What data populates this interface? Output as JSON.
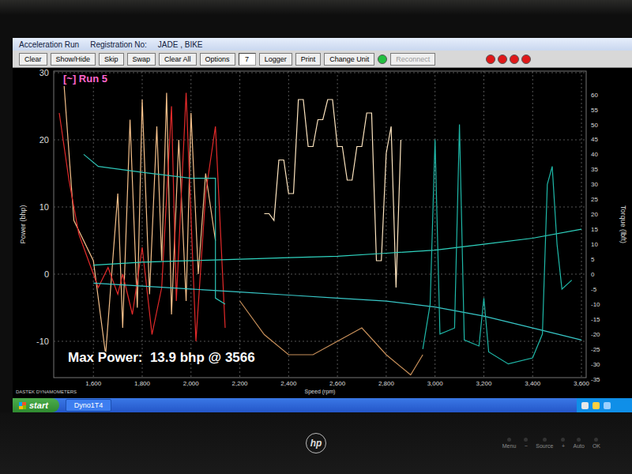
{
  "window": {
    "title": "Acceleration Run",
    "registration_label": "Registration No:",
    "registration": "JADE , BIKE"
  },
  "toolbar": [
    {
      "kind": "button",
      "label": "Clear",
      "disabled": false
    },
    {
      "kind": "button",
      "label": "Show/Hide",
      "disabled": false
    },
    {
      "kind": "button",
      "label": "Skip",
      "disabled": false
    },
    {
      "kind": "button",
      "label": "Swap",
      "disabled": false
    },
    {
      "kind": "button",
      "label": "Clear All",
      "disabled": false
    },
    {
      "kind": "button",
      "label": "Options",
      "disabled": false
    },
    {
      "kind": "field",
      "value": "7"
    },
    {
      "kind": "button",
      "label": "Logger",
      "disabled": false
    },
    {
      "kind": "button",
      "label": "Print",
      "disabled": false
    },
    {
      "kind": "button",
      "label": "Change Unit",
      "disabled": false
    },
    {
      "kind": "led",
      "color": "#22c040"
    },
    {
      "kind": "button",
      "label": "Reconnect",
      "disabled": true
    }
  ],
  "alarm_lights": [
    {
      "color": "#e01818"
    },
    {
      "color": "#e01818"
    },
    {
      "color": "#e01818"
    },
    {
      "color": "#e01818"
    }
  ],
  "chart": {
    "run_label": "[~] Run 5",
    "y_left": {
      "title": "Power (bhp)",
      "ticks": [
        "30",
        "20",
        "10",
        "0",
        "-10"
      ]
    },
    "y_right": {
      "title": "Torque (lbft)",
      "ticks": [
        "60",
        "55",
        "50",
        "45",
        "40",
        "35",
        "30",
        "25",
        "20",
        "15",
        "10",
        "5",
        "0",
        "-5",
        "-10",
        "-15",
        "-20",
        "-25",
        "-30",
        "-35"
      ]
    },
    "x": {
      "title": "Speed (rpm)",
      "ticks": [
        "1,600",
        "1,800",
        "2,000",
        "2,200",
        "2,400",
        "2,600",
        "2,800",
        "3,000",
        "3,200",
        "3,400",
        "3,600"
      ]
    },
    "series": [
      {
        "axis": "left",
        "color": "#f5c08a",
        "rpm": [
          1480,
          1520,
          1600,
          1650,
          1700,
          1720,
          1750,
          1780,
          1800,
          1830,
          1860,
          1880,
          1900,
          1920,
          1950,
          1980,
          2000,
          2030,
          2060,
          2100
        ],
        "values": [
          28,
          8,
          2,
          -12,
          12,
          -8,
          23,
          -5,
          26,
          -3,
          22,
          2,
          27,
          -6,
          20,
          -4,
          24,
          0,
          15,
          5
        ]
      },
      {
        "axis": "left",
        "color": "#ffe6c0",
        "rpm": [
          2300,
          2320,
          2340,
          2360,
          2380,
          2400,
          2420,
          2440,
          2460,
          2480,
          2500,
          2520,
          2540,
          2560,
          2580,
          2600,
          2620,
          2640,
          2660,
          2680,
          2700,
          2720,
          2740,
          2760,
          2780,
          2800,
          2820,
          2840,
          2860
        ],
        "values": [
          9,
          9,
          8,
          17,
          17,
          12,
          12,
          26,
          26,
          19,
          19,
          23,
          23,
          26,
          26,
          19,
          19,
          14,
          14,
          19,
          19,
          24,
          24,
          2,
          2,
          18,
          22,
          -2,
          20
        ]
      },
      {
        "axis": "left",
        "color": "#e52a2a",
        "rpm": [
          1460,
          1500,
          1540,
          1580,
          1620,
          1660,
          1700,
          1720,
          1760,
          1800,
          1840,
          1880,
          1920,
          1940,
          1980,
          2020,
          2060,
          2100,
          2140
        ],
        "values": [
          24,
          14,
          6,
          2,
          -2,
          1,
          -3,
          0,
          -6,
          4,
          -9,
          -2,
          25,
          -4,
          27,
          -10,
          12,
          22,
          -8
        ]
      },
      {
        "axis": "left",
        "color": "#c8905a",
        "rpm": [
          2200,
          2300,
          2400,
          2500,
          2600,
          2700,
          2800,
          2900,
          2950
        ],
        "values": [
          -4,
          -9,
          -12,
          -12,
          -10,
          -8,
          -12,
          -15,
          -12
        ]
      },
      {
        "axis": "right",
        "color": "#2fd4c0",
        "rpm": [
          1600,
          1800,
          2000,
          2200,
          2400,
          2600,
          2800,
          3000,
          3200,
          3400,
          3600
        ],
        "values": [
          3,
          4,
          4.5,
          5,
          5.5,
          6,
          7,
          8,
          10,
          12,
          15
        ]
      },
      {
        "axis": "right",
        "color": "#38c8c8",
        "rpm": [
          1600,
          1800,
          2000,
          2200,
          2400,
          2600,
          2800,
          3000,
          3200,
          3400,
          3600
        ],
        "values": [
          -3,
          -4,
          -5,
          -6,
          -7,
          -8,
          -9,
          -11,
          -14,
          -18,
          -22
        ]
      },
      {
        "axis": "right",
        "color": "#2ec4b6",
        "rpm": [
          1560,
          1620,
          1800,
          2000,
          2100,
          2100,
          2140
        ],
        "values": [
          40,
          36,
          34,
          32,
          32,
          -8,
          -10
        ]
      },
      {
        "axis": "right",
        "color": "#1fb8a8",
        "rpm": [
          2950,
          2980,
          3000,
          3020,
          3080,
          3100,
          3120,
          3180,
          3200,
          3220,
          3300,
          3400,
          3440,
          3460,
          3480,
          3500,
          3520,
          3560
        ],
        "values": [
          -25,
          -10,
          45,
          -20,
          -18,
          50,
          -22,
          -24,
          -8,
          -26,
          -30,
          -28,
          -20,
          30,
          36,
          10,
          -5,
          -2
        ]
      }
    ],
    "max_power": "Max Power:  13.9 bhp @ 3566",
    "brand": "DASTEK DYNAMOMETERS"
  },
  "taskbar": {
    "start": "start",
    "tasks": [
      "Dyno1T4"
    ]
  },
  "monitor": {
    "logo": "hp",
    "controls": [
      "Menu",
      "−",
      "Source",
      "+",
      "Auto",
      "OK"
    ]
  }
}
